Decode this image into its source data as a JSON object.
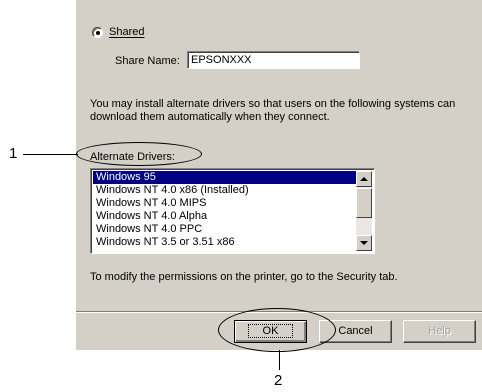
{
  "dialog": {
    "shared_radio_label": "Shared",
    "share_name_label": "Share Name:",
    "share_name_value": "EPSONXXX",
    "info_text": "You may install alternate drivers so that users on the following systems can download them automatically when they connect.",
    "alternate_drivers_label": "Alternate Drivers:",
    "drivers": [
      "Windows 95",
      "Windows NT 4.0 x86 (Installed)",
      "Windows NT 4.0 MIPS",
      "Windows NT 4.0 Alpha",
      "Windows NT 4.0 PPC",
      "Windows NT 3.5 or 3.51 x86"
    ],
    "selected_driver_index": 0,
    "permissions_text": "To modify the permissions on the printer, go to the Security tab.",
    "buttons": {
      "ok": "OK",
      "cancel": "Cancel",
      "help": "Help"
    }
  },
  "callouts": {
    "one": "1",
    "two": "2"
  }
}
